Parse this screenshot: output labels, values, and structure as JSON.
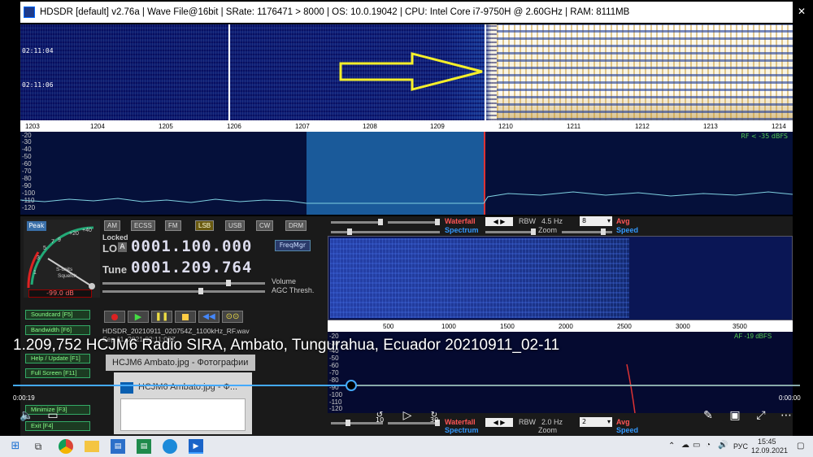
{
  "window": {
    "title": "HDSDR [default]  v2.76a  |  Wave File@16bit  |  SRate: 1176471 > 8000  |  OS: 10.0.19042   |  CPU: Intel Core i7-9750H @ 2.60GHz  |  RAM: 8111MB",
    "minimize": "—",
    "maximize": "☐",
    "close": "✕"
  },
  "waterfall": {
    "times": [
      "02:11:04",
      "02:11:06"
    ]
  },
  "scale": {
    "labels": [
      "1203",
      "1204",
      "1205",
      "1206",
      "1207",
      "1208",
      "1209",
      "1210",
      "1211",
      "1212",
      "1213",
      "1214"
    ]
  },
  "spectrum": {
    "db_labels": [
      "-20",
      "-30",
      "-40",
      "-50",
      "-60",
      "-70",
      "-80",
      "-90",
      "-100",
      "-110",
      "-120"
    ],
    "rf_label": "RF < -35 dBFS"
  },
  "modes": {
    "am": "AM",
    "ecss": "ECSS",
    "fm": "FM",
    "lsb": "LSB",
    "usb": "USB",
    "cw": "CW",
    "drm": "DRM"
  },
  "smeter": {
    "peak": "Peak",
    "scale": [
      "1",
      "3",
      "5",
      "7",
      "9",
      "+20",
      "+40"
    ],
    "label1": "S-units",
    "label2": "Squelch",
    "reading": "-99.0 dB"
  },
  "lo": {
    "locked": "Locked",
    "label": "LO",
    "a": "A",
    "value": "0001.100.000",
    "freqmgr": "FreqMgr"
  },
  "tune": {
    "label": "Tune",
    "value": "0001.209.764"
  },
  "sliders": {
    "volume": "Volume",
    "agc": "AGC Thresh."
  },
  "left_buttons": {
    "soundcard": "Soundcard  [F5]",
    "bandwidth": "Bandwidth  [F6]",
    "help": "Help / Update  [F1]",
    "fullscreen": "Full Screen  [F11]",
    "minimize": "Minimize  [F3]",
    "exit": "Exit  [F4]"
  },
  "file": {
    "name": "HDSDR_20210911_020754Z_1100kHz_RF.wav",
    "partial": "Sep 11, 2021  02:11:08Z"
  },
  "af_controls": {
    "waterfall": "Waterfall",
    "spectrum": "Spectrum",
    "rbw": "RBW",
    "rbw_value": "4.5 Hz",
    "dropdown": "8",
    "avg": "Avg",
    "speed": "Speed",
    "zoom": "Zoom"
  },
  "af_controls2": {
    "waterfall": "Waterfall",
    "spectrum": "Spectrum",
    "rbw": "RBW",
    "rbw_value": "2.0 Hz",
    "dropdown": "2",
    "avg": "Avg",
    "speed": "Speed",
    "zoom": "Zoom"
  },
  "af_scale": {
    "labels": [
      "500",
      "1000",
      "1500",
      "2000",
      "2500",
      "3000",
      "3500"
    ]
  },
  "af_spectrum": {
    "db_labels": [
      "-20",
      "-30",
      "-40",
      "-50",
      "-60",
      "-70",
      "-80",
      "-90",
      "-100",
      "-110",
      "-120"
    ],
    "af_label": "AF -19 dBFS"
  },
  "video": {
    "title": "1.209,752 HCJM6 Radio SIRA, Ambato, Tungurahua, Ecuador 20210911_02-11",
    "elapsed": "0:00:19",
    "remaining": "0:00:00",
    "progress": 0.43,
    "skip_back": "10",
    "skip_fwd": "30"
  },
  "photos_popup": {
    "title": "HCJM6 Ambato.jpg - Фотографии",
    "title_short": "HCJM6 Ambato.jpg - Ф..."
  },
  "taskbar": {
    "lang": "РУС",
    "time": "15:45",
    "date": "12.09.2021"
  },
  "colors": {
    "accent": "#3b9cff",
    "arrow": "#f5ef2a",
    "lsb_active": "#c8a000"
  }
}
